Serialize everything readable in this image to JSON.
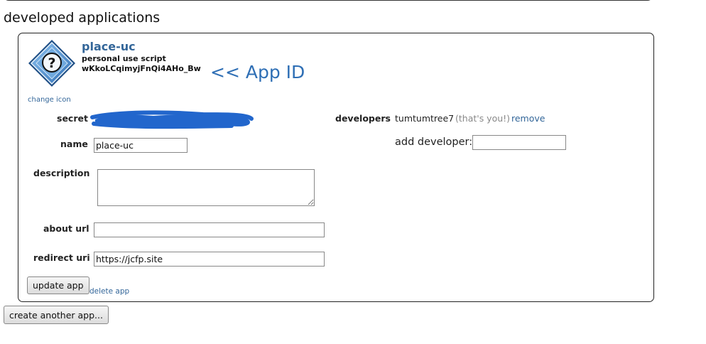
{
  "page": {
    "section_title": "developed applications"
  },
  "app": {
    "name": "place-uc",
    "type": "personal use script",
    "id": "wKkoLCqimyjFnQi4AHo_Bw",
    "id_annotation": "<< App ID",
    "change_icon_label": "change icon",
    "icon": "question-mark-diamond-icon",
    "secret_label": "secret",
    "secret_redaction_color": "#2266cc",
    "name_label": "name",
    "name_value": "place-uc",
    "description_label": "description",
    "description_value": "",
    "about_url_label": "about url",
    "about_url_value": "",
    "redirect_url_label": "redirect uri",
    "redirect_url_value": "https://jcfp.site",
    "update_button": "update app",
    "delete_link": "delete app"
  },
  "developers": {
    "label": "developers",
    "name": "tumtumtree7",
    "you_note": "(that's you!)",
    "remove_link": "remove",
    "add_label": "add developer:",
    "add_value": ""
  },
  "actions": {
    "create_another": "create another app..."
  },
  "colors": {
    "link": "#336699",
    "annotation": "#2f6fb5"
  }
}
